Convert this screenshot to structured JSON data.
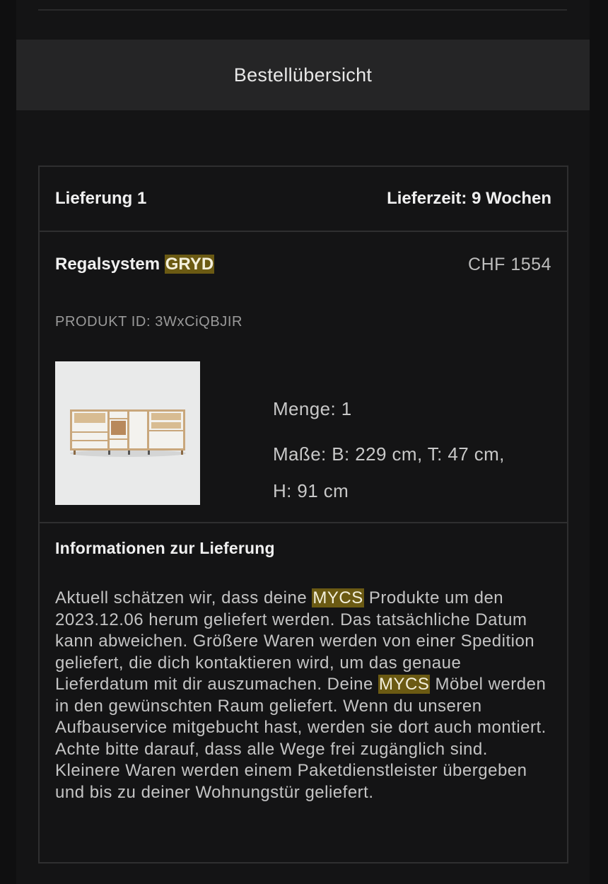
{
  "summary": {
    "label": "Bestellübersicht"
  },
  "delivery": {
    "title": "Lieferung 1",
    "time": "Lieferzeit: 9 Wochen"
  },
  "product": {
    "name_prefix": "Regalsystem ",
    "name_highlight": "GRYD",
    "price": "CHF 1554",
    "id": "PRODUKT ID: 3WxCiQBJIR",
    "quantity": "Menge: 1",
    "dimensions_line1": "Maße: B: 229 cm, T: 47 cm,",
    "dimensions_line2": "H: 91 cm",
    "image_icon": "shelf-product-image"
  },
  "info": {
    "title": "Informationen zur Lieferung",
    "text_part1": "Aktuell schätzen wir, dass deine ",
    "brand": "MYCS",
    "text_part2": " Produkte um den 2023.12.06 herum geliefert werden. Das tatsächliche Datum kann abweichen. Größere Waren werden von einer Spedition geliefert, die dich kontaktieren wird, um das genaue Lieferdatum mit dir auszumachen. Deine ",
    "text_part3": " Möbel werden in den gewünschten Raum geliefert. Wenn du unseren Aufbauservice mitgebucht hast, werden sie dort auch montiert. Achte bitte darauf, dass alle Wege frei zugänglich sind. Kleinere Waren werden einem Paketdienstleister übergeben und bis zu deiner Wohnungstür geliefert."
  },
  "colors": {
    "background": "#0f0f10",
    "panel": "#141415",
    "summary_bar": "#252526",
    "border": "#2f2f30",
    "highlight": "#6b5a13"
  }
}
